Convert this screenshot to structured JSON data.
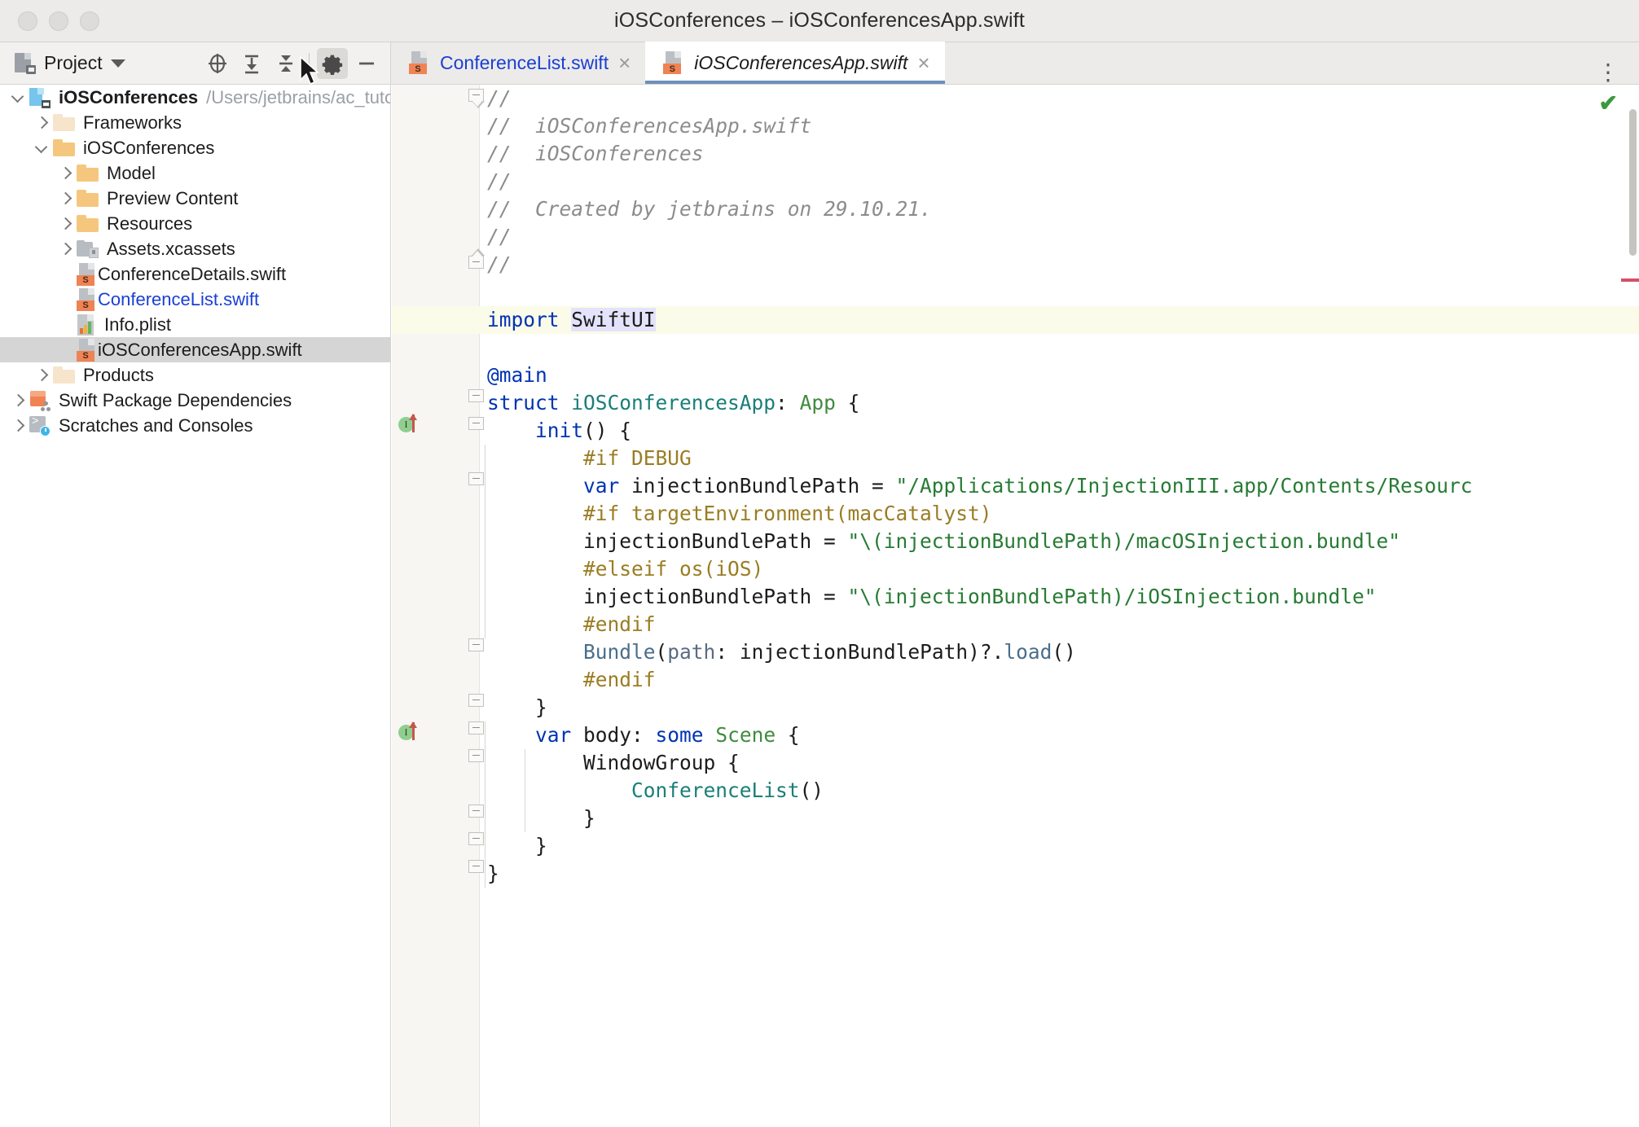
{
  "window": {
    "title": "iOSConferences – iOSConferencesApp.swift",
    "traffic_lights": [
      "close",
      "minimize",
      "zoom"
    ]
  },
  "toolbar": {
    "project_label": "Project",
    "dropdown_icon": "chevron-down-icon",
    "buttons": [
      {
        "name": "select-opened-file-icon",
        "glyph": "crosshair"
      },
      {
        "name": "expand-all-icon",
        "glyph": "expand"
      },
      {
        "name": "collapse-all-icon",
        "glyph": "collapse"
      },
      {
        "name": "settings-gear-icon",
        "glyph": "gear",
        "active": true
      },
      {
        "name": "hide-tool-window-icon",
        "glyph": "minus"
      }
    ]
  },
  "tabs": {
    "items": [
      {
        "label": "ConferenceList.swift",
        "active": false,
        "icon": "swift-file-icon",
        "close": "×"
      },
      {
        "label": "iOSConferencesApp.swift",
        "active": true,
        "icon": "swift-file-icon",
        "close": "×"
      }
    ],
    "overflow_icon": "more-options-icon",
    "overflow_glyph": "⋮"
  },
  "project_tree": {
    "items": [
      {
        "label": "iOSConferences",
        "suffix": "/Users/jetbrains/ac_tutoria",
        "indent": 0,
        "arrow": "open",
        "icon": "project-icon",
        "bold": true
      },
      {
        "label": "Frameworks",
        "indent": 1,
        "arrow": "closed",
        "icon": "folder-pale-icon"
      },
      {
        "label": "iOSConferences",
        "indent": 1,
        "arrow": "open",
        "icon": "folder-amber-icon"
      },
      {
        "label": "Model",
        "indent": 2,
        "arrow": "closed",
        "icon": "folder-amber-icon"
      },
      {
        "label": "Preview Content",
        "indent": 2,
        "arrow": "closed",
        "icon": "folder-amber-icon"
      },
      {
        "label": "Resources",
        "indent": 2,
        "arrow": "closed",
        "icon": "folder-amber-icon"
      },
      {
        "label": "Assets.xcassets",
        "indent": 2,
        "arrow": "closed",
        "icon": "assets-catalog-icon"
      },
      {
        "label": "ConferenceDetails.swift",
        "indent": 2,
        "arrow": "none",
        "icon": "swift-file-icon"
      },
      {
        "label": "ConferenceList.swift",
        "indent": 2,
        "arrow": "none",
        "icon": "swift-file-icon",
        "open_in_editor": true
      },
      {
        "label": "Info.plist",
        "indent": 2,
        "arrow": "none",
        "icon": "plist-file-icon"
      },
      {
        "label": "iOSConferencesApp.swift",
        "indent": 2,
        "arrow": "none",
        "icon": "swift-file-icon",
        "selected": true
      },
      {
        "label": "Products",
        "indent": 1,
        "arrow": "closed",
        "icon": "folder-pale-icon"
      },
      {
        "label": "Swift Package Dependencies",
        "indent": 0,
        "arrow": "closed",
        "icon": "swift-package-icon"
      },
      {
        "label": "Scratches and Consoles",
        "indent": 0,
        "arrow": "closed",
        "icon": "scratches-icon"
      }
    ]
  },
  "editor": {
    "filename": "iOSConferencesApp.swift",
    "inspection_status_icon": "checkmark-ok-icon",
    "inspection_status_glyph": "✔",
    "caret_line_index": 8,
    "selection_text": "SwiftUI",
    "lines": [
      "//",
      "//  iOSConferencesApp.swift",
      "//  iOSConferences",
      "//",
      "//  Created by jetbrains on 29.10.21.",
      "//",
      "//",
      "",
      "import SwiftUI",
      "",
      "@main",
      "struct iOSConferencesApp: App {",
      "    init() {",
      "        #if DEBUG",
      "        var injectionBundlePath = \"/Applications/InjectionIII.app/Contents/Resourc",
      "        #if targetEnvironment(macCatalyst)",
      "        injectionBundlePath = \"\\(injectionBundlePath)/macOSInjection.bundle\"",
      "        #elseif os(iOS)",
      "        injectionBundlePath = \"\\(injectionBundlePath)/iOSInjection.bundle\"",
      "        #endif",
      "        Bundle(path: injectionBundlePath)?.load()",
      "        #endif",
      "    }",
      "    var body: some Scene {",
      "        WindowGroup {",
      "            ConferenceList()",
      "        }",
      "    }",
      "}"
    ],
    "gutter_markers": [
      {
        "line_index": 12,
        "type": "implementing-member-icon",
        "glyph": "I"
      },
      {
        "line_index": 22,
        "type": "implementing-member-icon",
        "glyph": "I"
      }
    ]
  },
  "colors": {
    "accent_blue": "#1a3fd4",
    "keyword": "#0033b3",
    "type": "#1a7f77",
    "protocol": "#3f8b3f",
    "string": "#277b34",
    "preprocessor": "#9a7d23",
    "comment": "#8c8c8c",
    "selection": "#e4e3fb",
    "caret_row": "#fbfbe9",
    "tree_selected": "#d5d5d5",
    "swift_orange": "#ef8354",
    "ok_green": "#3c9a3c"
  }
}
